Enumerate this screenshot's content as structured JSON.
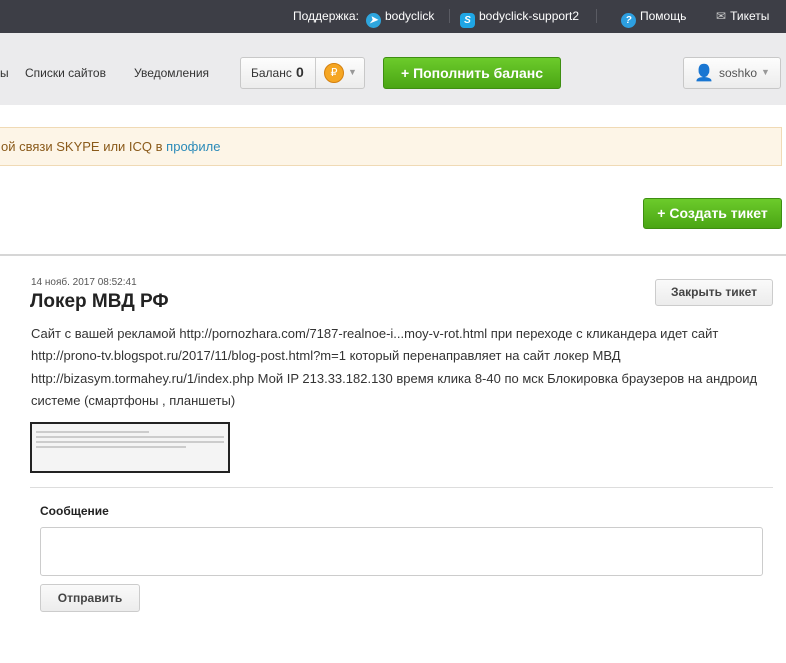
{
  "topbar": {
    "support_label": "Поддержка:",
    "telegram": "bodyclick",
    "skype": "bodyclick-support2",
    "help": "Помощь",
    "tickets": "Тикеты"
  },
  "nav": {
    "partial": "ы",
    "sites_lists": "Списки сайтов",
    "notifications": "Уведомления",
    "balance_label": "Баланс",
    "balance_value": "0",
    "currency_symbol": "₽",
    "topup": "Пополнить баланс",
    "user": "soshko"
  },
  "alert": {
    "text": "ой связи SKYPE или ICQ в ",
    "link": "профиле"
  },
  "create_ticket": "Создать тикет",
  "ticket": {
    "date": "14 нояб. 2017 08:52:41",
    "title": "Локер МВД РФ",
    "close": "Закрыть тикет",
    "body": "Сайт с вашей рекламой http://pornozhara.com/7187-realnoe-i...moy-v-rot.html при переходе с кликандера идет сайт http://prono-tv.blogspot.ru/2017/11/blog-post.html?m=1 который перенаправляет на сайт локер МВД http://bizasym.tormahey.ru/1/index.php Мой IP 213.33.182.130 время клика 8-40 по мск Блокировка браузеров на андроид системе (смартфоны , планшеты)"
  },
  "reply": {
    "label": "Сообщение",
    "value": "",
    "send": "Отправить"
  }
}
